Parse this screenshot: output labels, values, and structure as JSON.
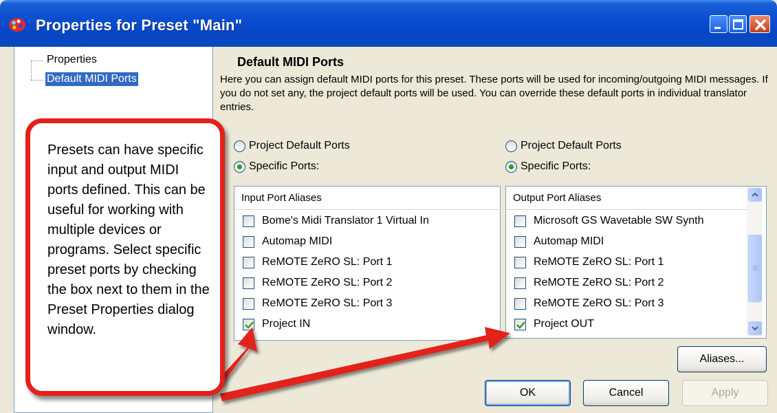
{
  "window": {
    "title": "Properties for Preset \"Main\"",
    "buttons": [
      "minimize",
      "maximize",
      "close"
    ]
  },
  "tree": {
    "items": [
      {
        "label": "Properties",
        "selected": false
      },
      {
        "label": "Default MIDI Ports",
        "selected": true
      }
    ]
  },
  "panel": {
    "heading": "Default MIDI Ports",
    "description": "Here you can assign default MIDI ports for this preset. These ports will be used for incoming/outgoing MIDI messages. If you do not set any, the project default ports will be used. You can override these default ports in individual translator entries."
  },
  "input": {
    "radio_project_default": "Project Default Ports",
    "radio_specific": "Specific Ports:",
    "selected": "specific",
    "header": "Input Port Aliases",
    "ports": [
      {
        "label": "Bome's Midi Translator 1 Virtual In",
        "checked": false
      },
      {
        "label": "Automap MIDI",
        "checked": false
      },
      {
        "label": "ReMOTE ZeRO SL: Port 1",
        "checked": false
      },
      {
        "label": "ReMOTE ZeRO SL: Port 2",
        "checked": false
      },
      {
        "label": "ReMOTE ZeRO SL: Port 3",
        "checked": false
      },
      {
        "label": "Project IN",
        "checked": true
      }
    ]
  },
  "output": {
    "radio_project_default": "Project Default Ports",
    "radio_specific": "Specific Ports:",
    "selected": "specific",
    "header": "Output Port Aliases",
    "ports": [
      {
        "label": "Microsoft GS Wavetable SW Synth",
        "checked": false
      },
      {
        "label": "Automap MIDI",
        "checked": false
      },
      {
        "label": "ReMOTE ZeRO SL: Port 1",
        "checked": false
      },
      {
        "label": "ReMOTE ZeRO SL: Port 2",
        "checked": false
      },
      {
        "label": "ReMOTE ZeRO SL: Port 3",
        "checked": false
      },
      {
        "label": "Project OUT",
        "checked": true
      }
    ]
  },
  "buttons": {
    "aliases": "Aliases...",
    "ok": "OK",
    "cancel": "Cancel",
    "apply": "Apply"
  },
  "callout": {
    "text": "Presets can have specific input and output MIDI ports defined.  This can be useful for working with multiple devices or programs. Select specific preset ports by checking the box next to them in the Preset Properties dialog window."
  },
  "colors": {
    "titlebar": "#0a4ed0",
    "selection": "#316ac5",
    "callout_border": "#e3201a",
    "arrow": "#e3201a",
    "check": "#21a121"
  }
}
